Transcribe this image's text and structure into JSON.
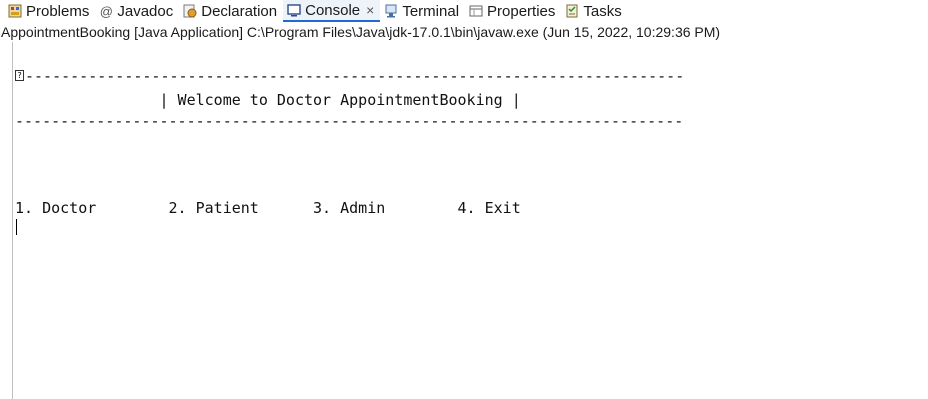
{
  "tabs": [
    {
      "label": "Problems",
      "icon": "problems-icon",
      "active": false
    },
    {
      "label": "Javadoc",
      "icon": "javadoc-icon",
      "active": false
    },
    {
      "label": "Declaration",
      "icon": "declaration-icon",
      "active": false
    },
    {
      "label": "Console",
      "icon": "console-icon",
      "active": true,
      "close": "×"
    },
    {
      "label": "Terminal",
      "icon": "terminal-icon",
      "active": false
    },
    {
      "label": "Properties",
      "icon": "properties-icon",
      "active": false
    },
    {
      "label": "Tasks",
      "icon": "tasks-icon",
      "active": false
    }
  ],
  "status": {
    "text": "AppointmentBooking [Java Application] C:\\Program Files\\Java\\jdk-17.0.1\\bin\\javaw.exe  (Jun 15, 2022, 10:29:36 PM)"
  },
  "console": {
    "line1": "-------------------------------------------------------------------------",
    "line2": "                | Welcome to Doctor AppointmentBooking |",
    "line3": "--------------------------------------------------------------------------",
    "menu": "1. Doctor        2. Patient      3. Admin        4. Exit",
    "box_glyph": "?"
  },
  "colors": {
    "active_tab_bg": "#eef3fa",
    "active_tab_border": "#1e6bd6"
  }
}
